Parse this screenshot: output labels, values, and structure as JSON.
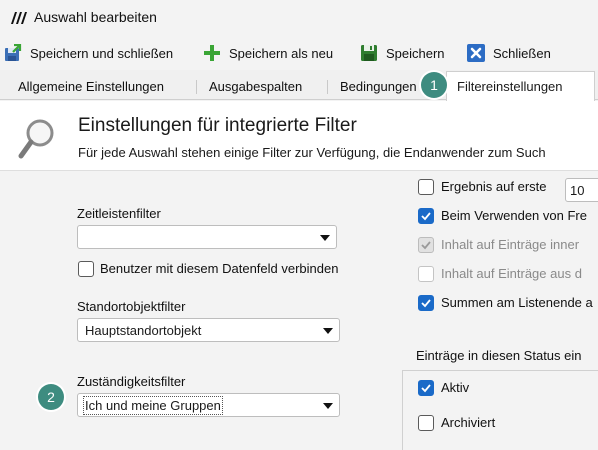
{
  "window": {
    "title": "Auswahl bearbeiten"
  },
  "toolbar": {
    "save_close": "Speichern und schließen",
    "save_new": "Speichern als neu",
    "save": "Speichern",
    "close": "Schließen"
  },
  "tabs": [
    {
      "label": "Allgemeine Einstellungen"
    },
    {
      "label": "Ausgabespalten"
    },
    {
      "label": "Bedingungen"
    },
    {
      "label": "Filtereinstellungen",
      "active": true
    }
  ],
  "header": {
    "title": "Einstellungen für integrierte Filter",
    "subtitle": "Für jede Auswahl stehen einige Filter zur Verfügung, die Endanwender zum Such"
  },
  "left": {
    "timeline_label": "Zeitleistenfilter",
    "timeline_value": "",
    "link_user_label": "Benutzer mit diesem Datenfeld verbinden",
    "link_user_checked": false,
    "location_label": "Standortobjektfilter",
    "location_value": "Hauptstandortobjekt",
    "responsibility_label": "Zuständigkeitsfilter",
    "responsibility_value": "Ich und meine Gruppen"
  },
  "right": {
    "first_results_label": "Ergebnis auf erste",
    "first_results_checked": false,
    "first_results_value": "10",
    "options": [
      {
        "label": "Beim Verwenden von Fre",
        "state": "checked"
      },
      {
        "label": "Inhalt auf Einträge inner",
        "state": "disabled-checked"
      },
      {
        "label": "Inhalt auf Einträge aus d",
        "state": "disabled"
      },
      {
        "label": "Summen am Listenende a",
        "state": "checked"
      }
    ],
    "status_group_label": "Einträge in diesen Status ein",
    "status_options": [
      {
        "label": "Aktiv",
        "state": "checked"
      },
      {
        "label": "Archiviert",
        "state": "unchecked"
      }
    ]
  },
  "badges": {
    "first": "1",
    "second": "2"
  },
  "colors": {
    "accent": "#1a6ac8",
    "badge": "#3e8c80",
    "save_green": "#3aa535"
  },
  "icons": [
    "app-logo-icon",
    "save-close-icon",
    "add-icon",
    "save-icon",
    "close-icon",
    "magnifier-icon",
    "dropdown-arrow-icon",
    "checkmark-icon"
  ]
}
